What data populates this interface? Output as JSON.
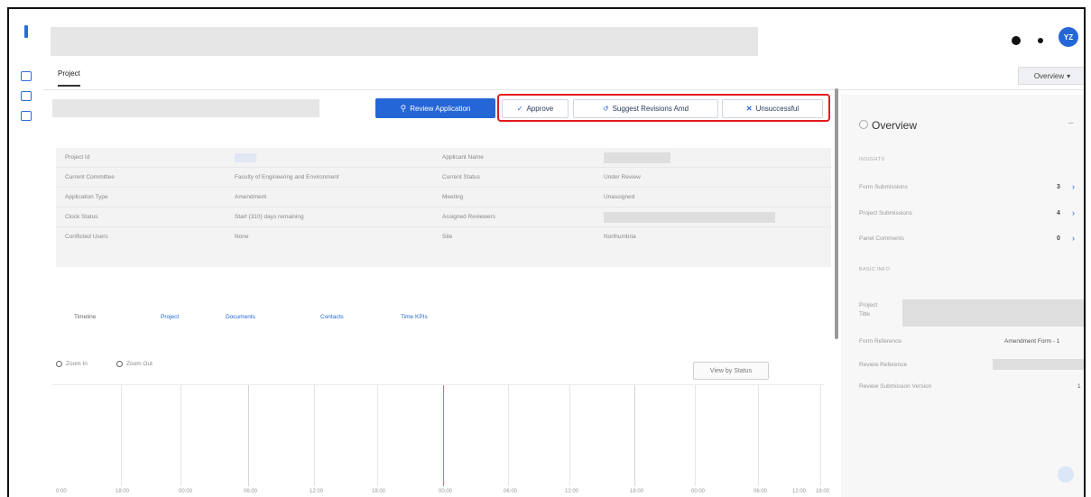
{
  "header": {
    "avatar_initials": "YZ"
  },
  "tabs": {
    "project": "Project",
    "overview_dropdown": "Overview"
  },
  "actions": {
    "review": "Review Application",
    "approve": "Approve",
    "suggest": "Suggest Revisions Amd",
    "unsuccessful": "Unsuccessful"
  },
  "details": {
    "rows": [
      {
        "label1": "Project Id",
        "value1": "",
        "label2": "Applicant Name",
        "value2": ""
      },
      {
        "label1": "Current Committee",
        "value1": "Faculty of Engineering and Environment",
        "label2": "Current Status",
        "value2": "Under Review"
      },
      {
        "label1": "Application Type",
        "value1": "Amendment",
        "label2": "Meeting",
        "value2": "Unassigned"
      },
      {
        "label1": "Clock Status",
        "value1": "Start (310) days remaining",
        "label2": "Assigned Reviewers",
        "value2": ""
      },
      {
        "label1": "Conflicted Users",
        "value1": "None",
        "label2": "Site",
        "value2": "Northumbria"
      }
    ]
  },
  "subtabs": [
    "Timeline",
    "Project",
    "Documents",
    "Contacts",
    "Time KPIs"
  ],
  "timeline": {
    "zoom_in": "Zoom In",
    "zoom_out": "Zoom Out",
    "view_by": "View by Status",
    "labels": [
      "0:00",
      "18:00",
      "00:00",
      "06:00",
      "12:00",
      "18:00",
      "00:00",
      "06:00",
      "12:00",
      "18:00",
      "00:00",
      "06:00",
      "12:00",
      "18:00"
    ]
  },
  "sidebar": {
    "title": "Overview",
    "insights_label": "INSIGHTS",
    "insights": [
      {
        "label": "Form Submissions",
        "value": "3"
      },
      {
        "label": "Project Submissions",
        "value": "4"
      },
      {
        "label": "Panel Comments",
        "value": "0"
      }
    ],
    "basic_label": "BASIC INFO",
    "project_title_label": "Project Title",
    "form_ref_label": "Form Reference",
    "form_ref_value": "Amendment Form - 1",
    "review_ref_label": "Review Reference",
    "review_version_label": "Review Submission Version",
    "review_version_value": "1"
  },
  "colors": {
    "primary": "#2466d6",
    "highlight": "#e21b1b",
    "today_line": "#e96b56"
  }
}
